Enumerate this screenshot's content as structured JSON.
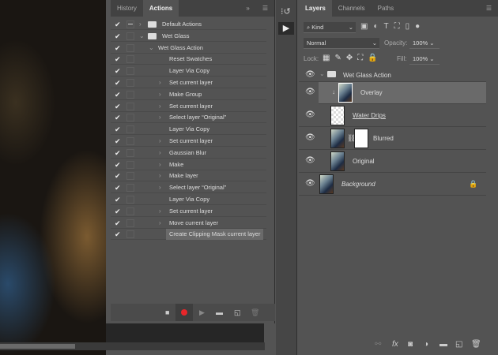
{
  "actions_panel": {
    "tabs": [
      "History",
      "Actions"
    ],
    "active_tab": "Actions",
    "rows": [
      {
        "label": "Default Actions",
        "level": 0,
        "type": "set",
        "expanded": false
      },
      {
        "label": "Wet Glass",
        "level": 0,
        "type": "set",
        "expanded": true
      },
      {
        "label": "Wet Glass Action",
        "level": 1,
        "type": "action",
        "expanded": true
      },
      {
        "label": "Reset Swatches",
        "level": 2,
        "chev": false
      },
      {
        "label": "Layer Via Copy",
        "level": 2,
        "chev": false
      },
      {
        "label": "Set current layer",
        "level": 2,
        "chev": true
      },
      {
        "label": "Make Group",
        "level": 2,
        "chev": true
      },
      {
        "label": "Set current layer",
        "level": 2,
        "chev": true
      },
      {
        "label": "Select layer “Original”",
        "level": 2,
        "chev": true
      },
      {
        "label": "Layer Via Copy",
        "level": 2,
        "chev": false
      },
      {
        "label": "Set current layer",
        "level": 2,
        "chev": true
      },
      {
        "label": "Gaussian Blur",
        "level": 2,
        "chev": true
      },
      {
        "label": "Make",
        "level": 2,
        "chev": true
      },
      {
        "label": "Make layer",
        "level": 2,
        "chev": true
      },
      {
        "label": "Select layer “Original”",
        "level": 2,
        "chev": true
      },
      {
        "label": "Layer Via Copy",
        "level": 2,
        "chev": false
      },
      {
        "label": "Set current layer",
        "level": 2,
        "chev": true
      },
      {
        "label": "Move current layer",
        "level": 2,
        "chev": true
      },
      {
        "label": "Create Clipping Mask current layer",
        "level": 2,
        "chev": false,
        "selected": true
      }
    ],
    "record_color": "#e8262a"
  },
  "layers_panel": {
    "tabs": [
      "Layers",
      "Channels",
      "Paths"
    ],
    "active_tab": "Layers",
    "filter": "Kind",
    "blend_mode": "Normal",
    "opacity_label": "Opacity:",
    "opacity": "100%",
    "lock_label": "Lock:",
    "fill_label": "Fill:",
    "fill": "100%",
    "group": "Wet Glass Action",
    "layers": [
      {
        "name": "Overlay",
        "selected": true,
        "clipped": true
      },
      {
        "name": "Water Drips",
        "transparent": true
      },
      {
        "name": "Blurred",
        "mask": true
      },
      {
        "name": "Original"
      },
      {
        "name": "Background",
        "locked": true,
        "italic": true
      }
    ]
  }
}
